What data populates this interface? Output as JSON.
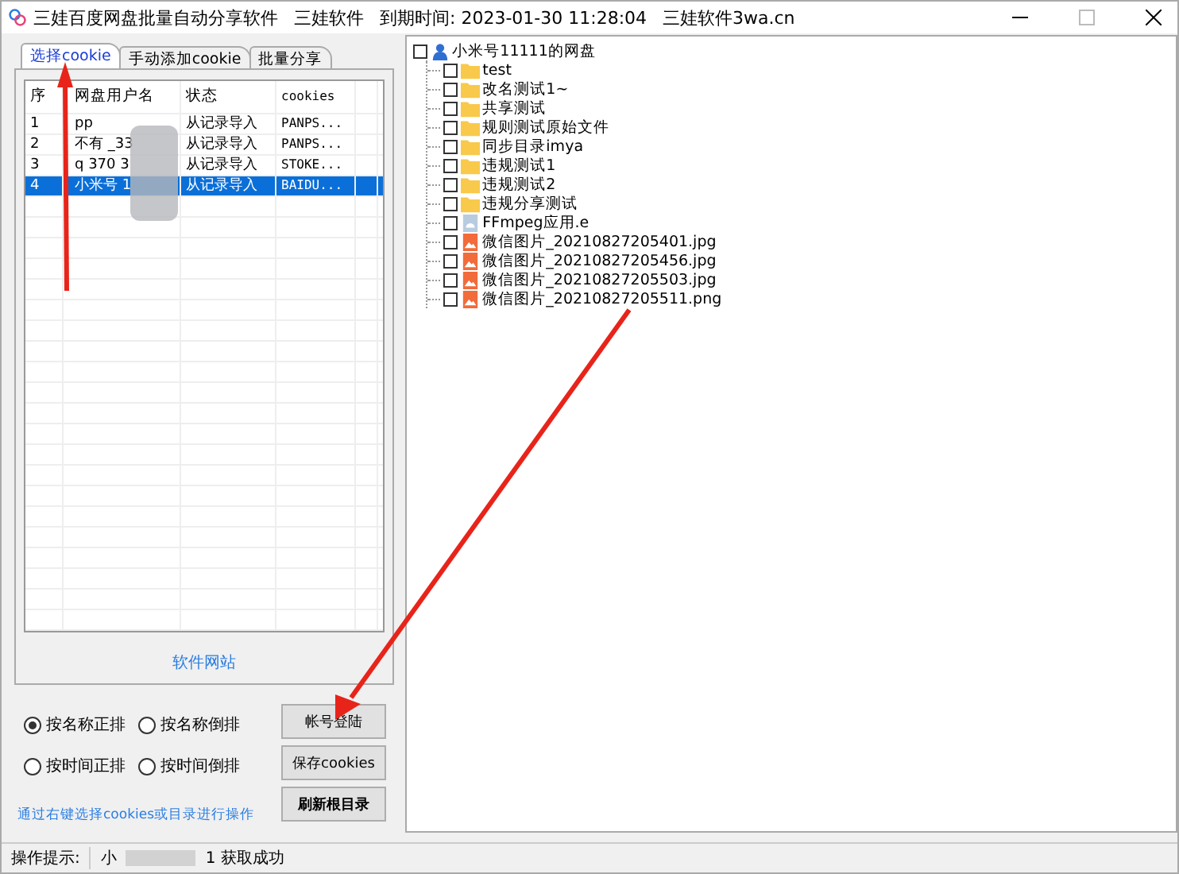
{
  "window": {
    "title": "三娃百度网盘批量自动分享软件",
    "brand": "三娃软件",
    "expiry": "到期时间: 2023-01-30 11:28:04",
    "site": "三娃软件3wa.cn"
  },
  "tabs": [
    {
      "label": "选择cookie",
      "selected": true
    },
    {
      "label": "手动添加cookie",
      "selected": false
    },
    {
      "label": "批量分享",
      "selected": false
    }
  ],
  "table": {
    "columns": [
      "序",
      "网盘用户名",
      "状态",
      "cookies"
    ],
    "rows": [
      {
        "cells": [
          "1",
          "pp",
          "从记录导入",
          "PANPS..."
        ],
        "selected": false
      },
      {
        "cells": [
          "2",
          "不有 _33",
          "从记录导入",
          "PANPS..."
        ],
        "selected": false
      },
      {
        "cells": [
          "3",
          "q 370 3",
          "从记录导入",
          "STOKE..."
        ],
        "selected": false
      },
      {
        "cells": [
          "4",
          "小米号 1",
          "从记录导入",
          "BAIDU..."
        ],
        "selected": true
      }
    ]
  },
  "website_link": "软件网站",
  "sort_options": [
    {
      "label": "按名称正排",
      "selected": true
    },
    {
      "label": "按名称倒排",
      "selected": false
    },
    {
      "label": "按时间正排",
      "selected": false
    },
    {
      "label": "按时间倒排",
      "selected": false
    }
  ],
  "buttons": [
    "帐号登陆",
    "保存cookies",
    "刷新根目录"
  ],
  "hint": "通过右键选择cookies或目录进行操作",
  "status_bar": {
    "label": "操作提示:",
    "message_start": "小",
    "message_end": "1 获取成功"
  },
  "tree": {
    "label": "小米号11111的网盘",
    "checked": false,
    "children": [
      {
        "label": "test",
        "kind": "folder",
        "checked": false
      },
      {
        "label": "改名测试1~",
        "kind": "folder",
        "checked": false
      },
      {
        "label": "共享测试",
        "kind": "folder",
        "checked": false
      },
      {
        "label": "规则测试原始文件",
        "kind": "folder",
        "checked": false
      },
      {
        "label": "同步目录imya",
        "kind": "folder",
        "checked": false
      },
      {
        "label": "违规测试1",
        "kind": "folder",
        "checked": false
      },
      {
        "label": "违规测试2",
        "kind": "folder",
        "checked": false
      },
      {
        "label": "违规分享测试",
        "kind": "folder",
        "checked": false
      },
      {
        "label": "FFmpeg应用.e",
        "kind": "file",
        "checked": false
      },
      {
        "label": "微信图片_20210827205401.jpg",
        "kind": "image",
        "checked": false
      },
      {
        "label": "微信图片_20210827205456.jpg",
        "kind": "image",
        "checked": false
      },
      {
        "label": "微信图片_20210827205503.jpg",
        "kind": "image",
        "checked": false
      },
      {
        "label": "微信图片_20210827205511.png",
        "kind": "image",
        "checked": false
      }
    ]
  }
}
